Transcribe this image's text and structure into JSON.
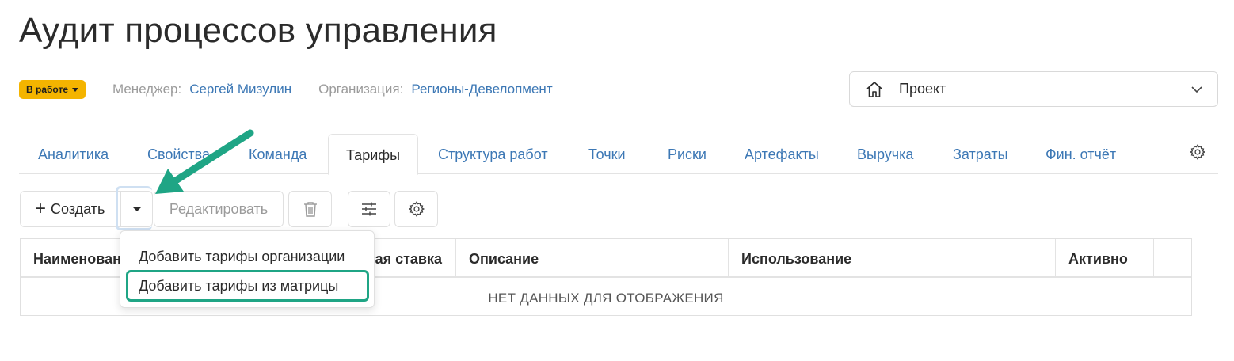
{
  "page": {
    "title": "Аудит процессов управления"
  },
  "meta": {
    "status": "В работе",
    "manager_label": "Менеджер:",
    "manager_value": "Сергей Мизулин",
    "org_label": "Организация:",
    "org_value": "Регионы-Девелопмент"
  },
  "project_select": {
    "icon": "home-icon",
    "value": "Проект"
  },
  "tabs": [
    {
      "label": "Аналитика"
    },
    {
      "label": "Свойства"
    },
    {
      "label": "Команда"
    },
    {
      "label": "Тарифы",
      "active": true
    },
    {
      "label": "Структура работ"
    },
    {
      "label": "Точки"
    },
    {
      "label": "Риски"
    },
    {
      "label": "Артефакты"
    },
    {
      "label": "Выручка"
    },
    {
      "label": "Затраты"
    },
    {
      "label": "Фин. отчёт"
    }
  ],
  "toolbar": {
    "create_label": "Создать",
    "edit_label": "Редактировать"
  },
  "dropdown_menu": {
    "items": [
      {
        "label": "Добавить тарифы организации"
      },
      {
        "label": "Добавить тарифы из матрицы",
        "highlighted": true
      }
    ]
  },
  "table": {
    "columns": [
      {
        "label": "Наименован"
      },
      {
        "label": "ая ставка"
      },
      {
        "label": "Описание"
      },
      {
        "label": "Использование"
      },
      {
        "label": "Активно"
      },
      {
        "label": ""
      }
    ],
    "empty_text": "НЕТ ДАННЫХ ДЛЯ ОТОБРАЖЕНИЯ"
  },
  "colors": {
    "accent": "#3d78b5",
    "status": "#f4b400",
    "highlight": "#1fa585"
  }
}
